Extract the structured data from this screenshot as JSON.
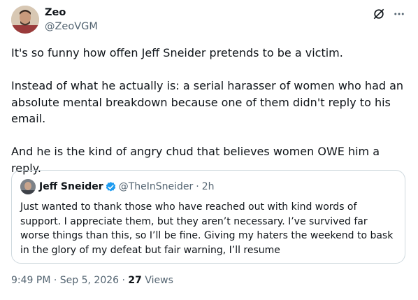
{
  "author": {
    "display_name": "Zeo",
    "handle": "@ZeoVGM",
    "avatar_icon": "person-avatar"
  },
  "tweet": {
    "paragraphs": [
      "It's so funny how offen Jeff Sneider pretends to be a victim.",
      "Instead of what he actually is: a serial harasser of women who had an absolute mental breakdown because one of them didn't reply to his email.",
      "And he is the kind of angry chud that believes women OWE him a reply."
    ]
  },
  "quote": {
    "display_name": "Jeff Sneider",
    "handle": "@TheInSneider",
    "separator": "·",
    "time_ago": "2h",
    "text": "Just wanted to thank those who have reached out with kind words of support. I appreciate them, but they aren’t necessary. I’ve survived far worse things than this, so I’ll be fine. Giving my haters the weekend to bask in the glory of my defeat but fair warning, I’ll resume",
    "verified_color": "#1d9bf0"
  },
  "footer": {
    "time": "9:49 PM",
    "separator1": "·",
    "date": "Sep 5, 2026",
    "separator2": "·",
    "views_count": "27",
    "views_label": "Views"
  },
  "icons": {
    "grok": "grok-icon",
    "more": "more-icon",
    "verified": "verified-badge-icon"
  },
  "colors": {
    "text": "#0f1419",
    "secondary": "#536471",
    "border": "#cfd9de",
    "verified": "#1d9bf0"
  }
}
